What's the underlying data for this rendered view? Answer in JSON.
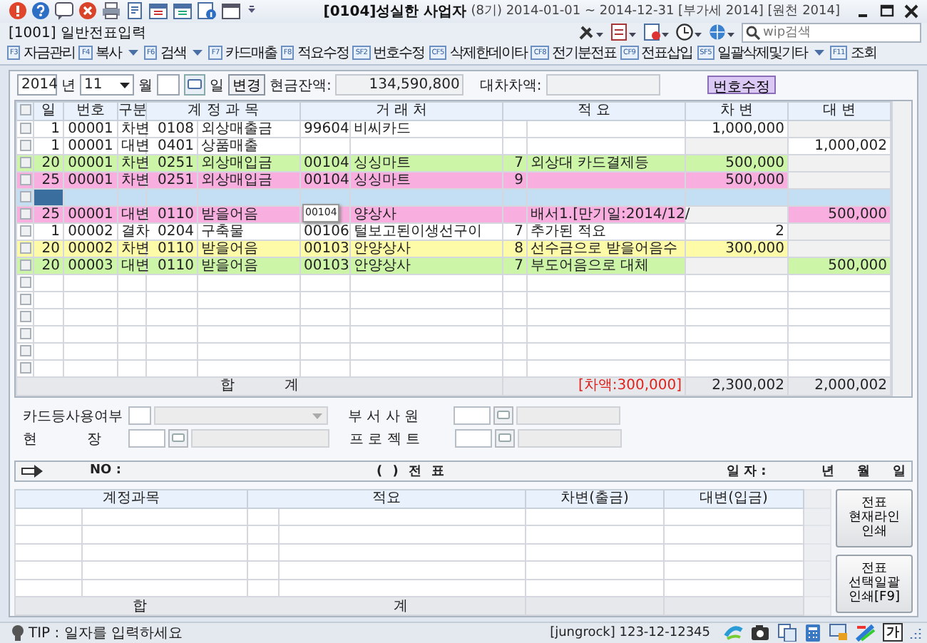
{
  "window": {
    "company": "[0104]성실한 사업자",
    "period": "(8기) 2014-01-01 ~ 2014-12-31 [부가세 2014] [원천 2014]",
    "screen": "[1001] 일반전표입력",
    "search_placeholder": "wip검색"
  },
  "toolbar": [
    {
      "key": "F3",
      "label": "자금관리",
      "dropdown": false
    },
    {
      "key": "F4",
      "label": "복사",
      "dropdown": true
    },
    {
      "key": "F6",
      "label": "검색",
      "dropdown": true
    },
    {
      "key": "F7",
      "label": "카드매출",
      "dropdown": false
    },
    {
      "key": "F8",
      "label": "적요수정",
      "dropdown": false
    },
    {
      "key": "SF2",
      "label": "번호수정",
      "dropdown": false
    },
    {
      "key": "CF5",
      "label": "삭제한데이타",
      "dropdown": false
    },
    {
      "key": "CF8",
      "label": "전기분전표",
      "dropdown": false
    },
    {
      "key": "CF9",
      "label": "전표삽입",
      "dropdown": false
    },
    {
      "key": "SF5",
      "label": "일괄삭제및기타",
      "dropdown": true
    },
    {
      "key": "F11",
      "label": "조회",
      "dropdown": false
    }
  ],
  "filter": {
    "year": "2014",
    "year_label": "년",
    "month": "11",
    "month_label": "월",
    "day_label": "일",
    "change_button": "변경",
    "cash_label": "현금잔액:",
    "cash": "134,590,800",
    "diff_label": "대차차액:",
    "renumber_button": "번호수정"
  },
  "table": {
    "columns": [
      "일",
      "번호",
      "구분",
      "계 정 과 목",
      "거 래 처",
      "적 요",
      "차 변",
      "대 변"
    ],
    "rows": [
      {
        "day": "1",
        "no": "00001",
        "type": "차변",
        "account_code": "0108",
        "account": "외상매출금",
        "partner_code": "99604",
        "partner": "비씨카드",
        "memo_code": "",
        "memo": "",
        "debit": "1,000,000",
        "credit": "",
        "color": "#ffffff",
        "selected": false,
        "checked": false
      },
      {
        "day": "1",
        "no": "00001",
        "type": "대변",
        "account_code": "0401",
        "account": "상품매출",
        "partner_code": "",
        "partner": "",
        "memo_code": "",
        "memo": "",
        "debit": "",
        "credit": "1,000,002",
        "color": "#ffffff",
        "selected": false,
        "checked": false
      },
      {
        "day": "20",
        "no": "00001",
        "type": "차변",
        "account_code": "0251",
        "account": "외상매입금",
        "partner_code": "00104",
        "partner": "싱싱마트",
        "memo_code": "7",
        "memo": "외상대 카드결제등",
        "debit": "500,000",
        "credit": "",
        "color": "#ccf5a8",
        "selected": false,
        "checked": false
      },
      {
        "day": "25",
        "no": "00001",
        "type": "차변",
        "account_code": "0251",
        "account": "외상매입금",
        "partner_code": "00104",
        "partner": "싱싱마트",
        "memo_code": "9",
        "memo": "",
        "debit": "500,000",
        "credit": "",
        "color": "#f9aee0",
        "selected": false,
        "checked": false
      },
      {
        "day": "",
        "no": "",
        "type": "",
        "account_code": "",
        "account": "",
        "partner_code": "",
        "partner": "",
        "memo_code": "",
        "memo": "",
        "debit": "",
        "credit": "",
        "color": "#c4dff3",
        "selected": true,
        "checked": false
      },
      {
        "day": "25",
        "no": "00001",
        "type": "대변",
        "account_code": "0110",
        "account": "받을어음",
        "partner_code": "",
        "partner": "양상사",
        "memo_code": "",
        "memo": "배서1.[만기일:2014/12/",
        "debit": "",
        "credit": "500,000",
        "color": "#f9aee0",
        "selected": false,
        "checked": false,
        "tooltip": "00104"
      },
      {
        "day": "1",
        "no": "00002",
        "type": "결차",
        "account_code": "0204",
        "account": "구축물",
        "partner_code": "00106",
        "partner": "털보고된이생선구이",
        "memo_code": "7",
        "memo": "추가된 적요",
        "debit": "2",
        "credit": "",
        "color": "#ffffff",
        "selected": false,
        "checked": false
      },
      {
        "day": "20",
        "no": "00002",
        "type": "차변",
        "account_code": "0110",
        "account": "받을어음",
        "partner_code": "00103",
        "partner": "안양상사",
        "memo_code": "8",
        "memo": "선수금으로 받을어음수",
        "debit": "300,000",
        "credit": "",
        "color": "#fdfaa8",
        "selected": false,
        "checked": false
      },
      {
        "day": "20",
        "no": "00003",
        "type": "대변",
        "account_code": "0110",
        "account": "받을어음",
        "partner_code": "00103",
        "partner": "안양상사",
        "memo_code": "7",
        "memo": "부도어음으로 대체",
        "debit": "",
        "credit": "500,000",
        "color": "#ccf5a8",
        "selected": false,
        "checked": false
      }
    ],
    "all_checked": false,
    "empty_rows": [
      {
        "checked": false
      },
      {
        "checked": false
      },
      {
        "checked": false
      },
      {
        "checked": false
      },
      {
        "checked": false
      },
      {
        "checked": false
      }
    ],
    "total_label": "합 계",
    "difference": "[차액:300,000]",
    "total_debit": "2,300,002",
    "total_credit": "2,000,002"
  },
  "form": {
    "card_label": "카드등사용여부",
    "dept_label": "부 서 사 원",
    "site_label": "현 장",
    "project_label": "프 로 젝 트"
  },
  "voucher": {
    "no_label": "NO :",
    "type_label": "(          ) 전 표",
    "date_label": "일 자 :",
    "y": "년",
    "m": "월",
    "d": "일",
    "columns": [
      "계정과목",
      "적요",
      "차변(출금)",
      "대변(입금)"
    ],
    "total_label": "합 계"
  },
  "side_buttons": [
    "전표 현재라인 인쇄",
    "전표 선택일괄 인쇄[F9]"
  ],
  "status_bar": {
    "tip": "TIP : 일자를 입력하세요",
    "user": "[jungrock]  123-12-12345",
    "ime": "가"
  }
}
